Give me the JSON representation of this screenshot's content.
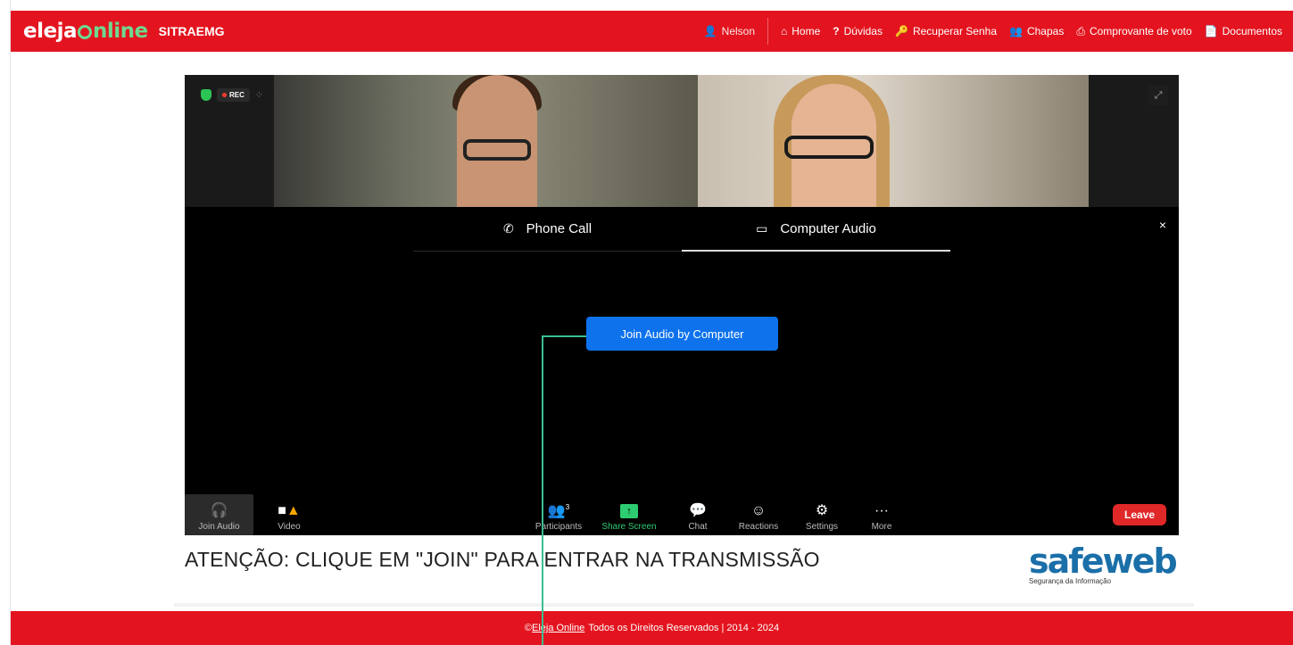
{
  "header": {
    "logo_eleja": "eleja",
    "logo_nline": "nline",
    "org": "SITRAEMG",
    "user": "Nelson",
    "nav": [
      {
        "icon": "home-icon",
        "glyph": "⌂",
        "label": "Home"
      },
      {
        "icon": "question-icon",
        "glyph": "?",
        "label": "Dúvidas"
      },
      {
        "icon": "key-icon",
        "glyph": "🔑",
        "label": "Recuperar Senha"
      },
      {
        "icon": "users-icon",
        "glyph": "👥",
        "label": "Chapas"
      },
      {
        "icon": "print-icon",
        "glyph": "⎙",
        "label": "Comprovante de voto"
      },
      {
        "icon": "document-icon",
        "glyph": "📄",
        "label": "Documentos"
      }
    ]
  },
  "meeting": {
    "rec_label": "REC",
    "tabs": [
      {
        "label": "Phone Call",
        "active": false
      },
      {
        "label": "Computer Audio",
        "active": true
      }
    ],
    "close_label": "×",
    "join_button": "Join Audio by Computer",
    "participants_count": "3",
    "toolbar": {
      "join_audio": "Join Audio",
      "video": "Video",
      "participants": "Participants",
      "share_screen": "Share Screen",
      "chat": "Chat",
      "reactions": "Reactions",
      "settings": "Settings",
      "more": "More",
      "leave": "Leave"
    }
  },
  "attention": "ATENÇÃO: CLIQUE EM \"JOIN\" PARA ENTRAR NA TRANSMISSÃO",
  "sponsor": {
    "name": "safeweb",
    "tagline": "Segurança da Informação"
  },
  "footer": {
    "copyright": "©",
    "link": "Eleja Online",
    "rest": "Todos os Direitos Reservados | 2014 - 2024"
  },
  "colors": {
    "brand_red": "#e3141f",
    "brand_green": "#6fd88f",
    "zoom_blue": "#0e72ed",
    "leave_red": "#e02828",
    "share_green": "#2ecc71",
    "annotation_line": "#3bbf8f"
  }
}
